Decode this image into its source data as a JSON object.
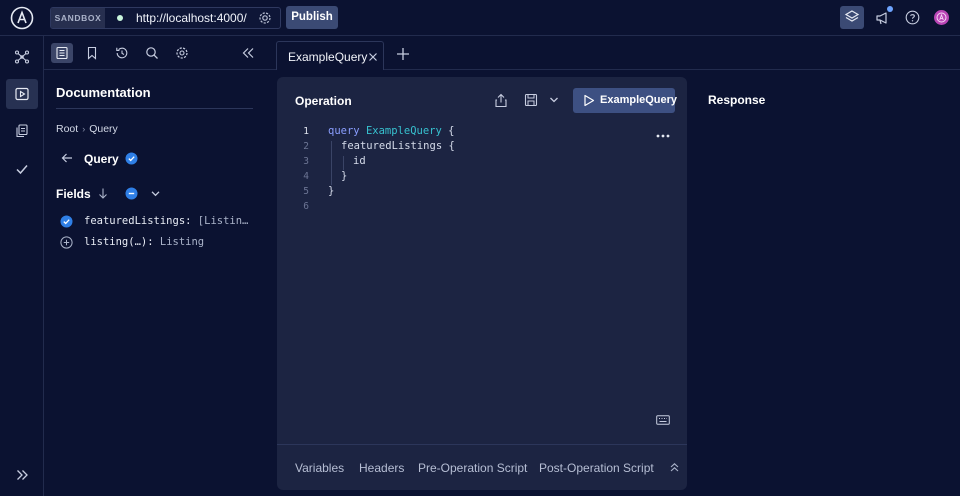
{
  "topbar": {
    "sandbox_label": "SANDBOX",
    "url": "http://localhost:4000/",
    "publish_label": "Publish"
  },
  "leftnav": {
    "items": [
      "schema-icon",
      "explorer-icon",
      "checks-icon",
      "launches-icon"
    ],
    "active": "explorer-icon",
    "collapse": "double-chevron-right-icon"
  },
  "doc_toolbar": {
    "icons": [
      "documentation-icon",
      "bookmark-icon",
      "history-icon",
      "search-icon",
      "settings-icon",
      "collapse-left-icon"
    ],
    "active": "documentation-icon"
  },
  "documentation": {
    "title": "Documentation",
    "breadcrumb": [
      "Root",
      "Query"
    ],
    "breadcrumb_sep": "›",
    "current_type": "Query",
    "fields_label": "Fields",
    "fields": [
      {
        "name": "featuredListings:",
        "type": "[Listin…",
        "state": "selected"
      },
      {
        "name": "listing(…):",
        "type": "Listing",
        "state": "add"
      }
    ]
  },
  "tabs": {
    "items": [
      {
        "label": "ExampleQuery",
        "active": true
      }
    ],
    "new_tab": "plus-icon"
  },
  "operation": {
    "title": "Operation",
    "run_label": "ExampleQuery",
    "line_numbers": [
      "1",
      "2",
      "3",
      "4",
      "5",
      "6"
    ],
    "code": {
      "kw": "query",
      "op_name": "ExampleQuery",
      "open1": " {",
      "line2": "featuredListings {",
      "line3": "id",
      "line4": "}",
      "line5": "}"
    },
    "footer_tabs": [
      "Variables",
      "Headers",
      "Pre-Operation Script",
      "Post-Operation Script"
    ]
  },
  "response": {
    "title": "Response"
  },
  "colors": {
    "background": "#0b1231",
    "panel": "#1c2442",
    "accent_button": "#3d5082",
    "check_blue": "#2f7fe6",
    "keyword": "#8a9eff",
    "operation_name": "#37c1cf"
  }
}
